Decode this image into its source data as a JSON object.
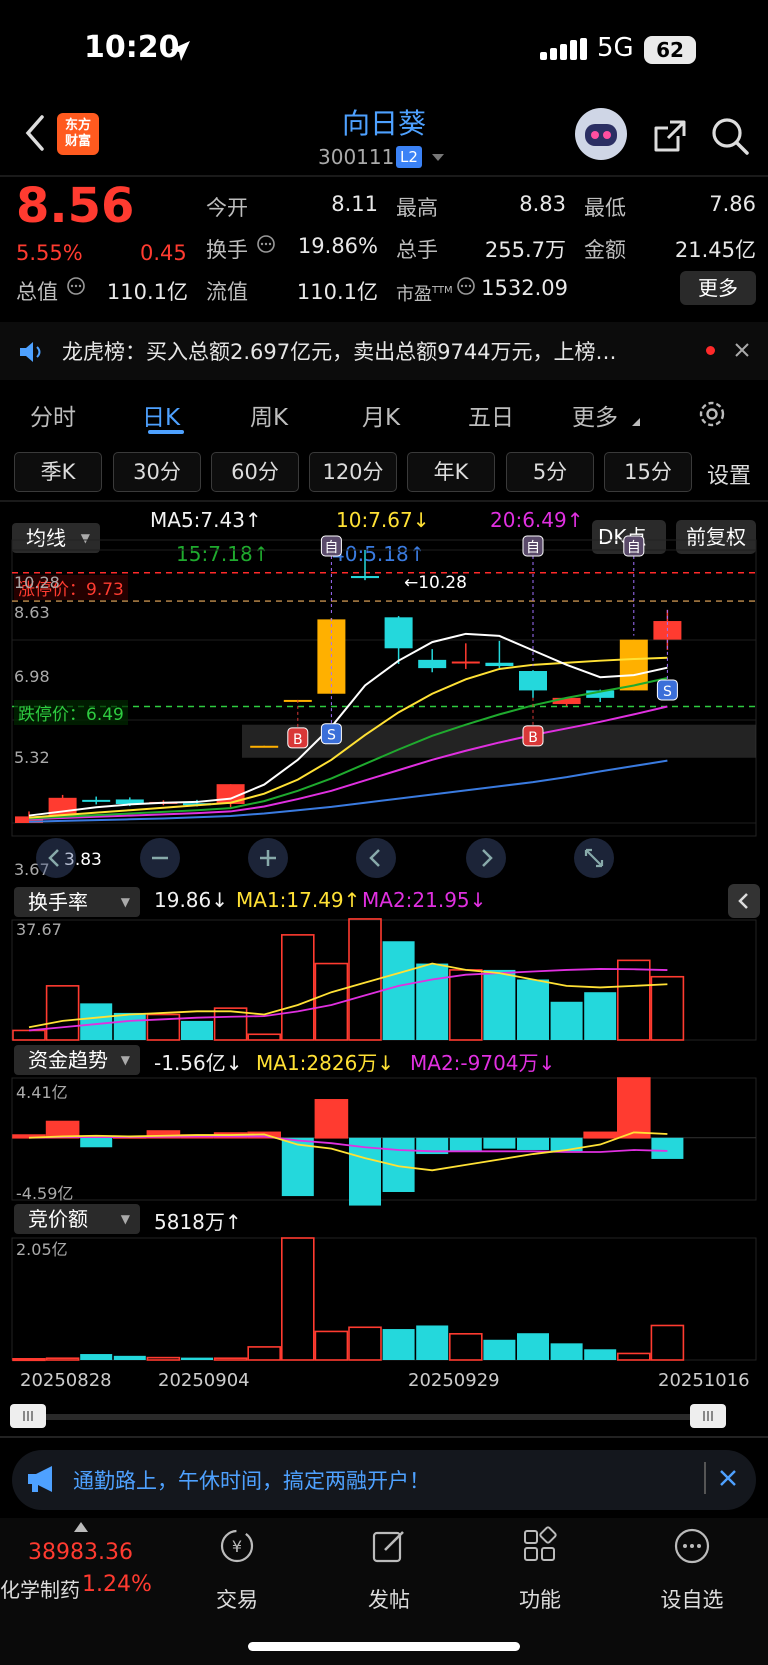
{
  "status_bar": {
    "time": "10:20",
    "network": "5G",
    "battery": "62"
  },
  "header": {
    "logo_text_1": "东方",
    "logo_text_2": "财富",
    "stock_name": "向日葵",
    "stock_code": "300111",
    "level": "L2"
  },
  "quote": {
    "price": "8.56",
    "change_pct": "5.55%",
    "change": "0.45",
    "open_label": "今开",
    "open": "8.11",
    "high_label": "最高",
    "high": "8.83",
    "low_label": "最低",
    "low": "7.86",
    "turnover_label": "换手",
    "turnover": "19.86%",
    "volume_label": "总手",
    "volume": "255.7万",
    "amount_label": "金额",
    "amount": "21.45亿",
    "mktcap_label": "总值",
    "mktcap": "110.1亿",
    "float_label": "流值",
    "float": "110.1亿",
    "pe_label": "市盈",
    "pe_sup": "TTM",
    "pe": "1532.09",
    "more_label": "更多"
  },
  "news": {
    "text": "龙虎榜：买入总额2.697亿元，卖出总额9744万元，上榜…"
  },
  "tabs": [
    "分时",
    "日K",
    "周K",
    "月K",
    "五日",
    "更多"
  ],
  "periods": [
    "季K",
    "30分",
    "60分",
    "120分",
    "年K",
    "5分",
    "15分"
  ],
  "settings_label": "设置",
  "ma_legend": {
    "selector": "均线",
    "ma5": "MA5:7.43↑",
    "ma10": "10:7.67↓",
    "ma20": "20:6.49↑",
    "ma15": "15:7.18↑",
    "ma40": "40:5.18↑",
    "dk_label": "DK点",
    "adjust_label": "前复权"
  },
  "colors": {
    "up": "#ff3b30",
    "down": "#24d8dc",
    "yellow_candle": "#ffb000",
    "ma5": "#ffffff",
    "ma10": "#ffe135",
    "ma20": "#e030e0",
    "ma15": "#1faa2e",
    "ma40": "#3a7be0",
    "accent": "#4ea1ff"
  },
  "chart_data": [
    {
      "type": "candlestick",
      "title": "日K",
      "y_ticks": [
        "10.28",
        "8.63",
        "6.98",
        "5.32",
        "3.67"
      ],
      "limit_up_label": "涨停价：9.73",
      "limit_up": 9.73,
      "limit_down_label": "跌停价：6.49",
      "limit_down": 6.49,
      "current_price_line": 8.56,
      "high_marker": "←10.28",
      "low_marker": "3.83",
      "x_labels": [
        "20250828",
        "20250904",
        "20250929",
        "20251016"
      ],
      "ylim": [
        3.67,
        10.28
      ],
      "candles": [
        {
          "o": 3.67,
          "c": 3.83,
          "h": 3.95,
          "l": 3.67,
          "color": "up"
        },
        {
          "o": 3.83,
          "c": 4.28,
          "h": 4.35,
          "l": 3.78,
          "color": "up"
        },
        {
          "o": 4.23,
          "c": 4.2,
          "h": 4.31,
          "l": 4.12,
          "color": "down"
        },
        {
          "o": 4.24,
          "c": 4.13,
          "h": 4.29,
          "l": 4.08,
          "color": "down"
        },
        {
          "o": 4.17,
          "c": 4.18,
          "h": 4.22,
          "l": 4.1,
          "color": "up"
        },
        {
          "o": 4.15,
          "c": 4.13,
          "h": 4.23,
          "l": 4.07,
          "color": "down"
        },
        {
          "o": 4.13,
          "c": 4.61,
          "h": 4.61,
          "l": 4.05,
          "color": "up"
        },
        {
          "o": 5.52,
          "c": 5.54,
          "h": 5.54,
          "l": 5.52,
          "color": "yellow_candle"
        },
        {
          "o": 6.65,
          "c": 6.65,
          "h": 6.65,
          "l": 6.65,
          "color": "yellow_candle"
        },
        {
          "o": 6.8,
          "c": 8.6,
          "h": 8.63,
          "l": 6.8,
          "color": "yellow_candle"
        },
        {
          "o": 9.65,
          "c": 9.6,
          "h": 10.28,
          "l": 9.55,
          "color": "down"
        },
        {
          "o": 8.65,
          "c": 7.9,
          "h": 8.68,
          "l": 7.52,
          "color": "down"
        },
        {
          "o": 7.62,
          "c": 7.42,
          "h": 7.88,
          "l": 7.32,
          "color": "down"
        },
        {
          "o": 7.55,
          "c": 7.58,
          "h": 8.02,
          "l": 7.4,
          "color": "up"
        },
        {
          "o": 7.55,
          "c": 7.47,
          "h": 8.08,
          "l": 7.42,
          "color": "down"
        },
        {
          "o": 7.35,
          "c": 6.88,
          "h": 7.37,
          "l": 6.7,
          "color": "down"
        },
        {
          "o": 6.7,
          "c": 6.55,
          "h": 6.72,
          "l": 6.5,
          "color": "up"
        },
        {
          "o": 6.88,
          "c": 6.7,
          "h": 6.9,
          "l": 6.6,
          "color": "down"
        },
        {
          "o": 6.88,
          "c": 8.11,
          "h": 8.11,
          "l": 6.88,
          "color": "yellow_candle"
        },
        {
          "o": 8.11,
          "c": 8.56,
          "h": 8.83,
          "l": 7.86,
          "color": "up"
        }
      ],
      "ma5": [
        3.85,
        3.95,
        4.05,
        4.12,
        4.16,
        4.18,
        4.26,
        4.6,
        5.2,
        6.0,
        7.0,
        7.6,
        8.05,
        8.25,
        8.2,
        7.85,
        7.5,
        7.2,
        7.25,
        7.43
      ],
      "ma10": [
        3.8,
        3.86,
        3.92,
        3.98,
        4.04,
        4.1,
        4.16,
        4.38,
        4.72,
        5.2,
        5.8,
        6.35,
        6.8,
        7.15,
        7.4,
        7.5,
        7.55,
        7.6,
        7.64,
        7.67
      ],
      "ma15": [
        3.78,
        3.82,
        3.86,
        3.9,
        3.94,
        3.98,
        4.03,
        4.2,
        4.45,
        4.75,
        5.1,
        5.45,
        5.78,
        6.05,
        6.3,
        6.52,
        6.7,
        6.85,
        7.0,
        7.18
      ],
      "ma20": [
        3.76,
        3.79,
        3.82,
        3.85,
        3.88,
        3.91,
        3.95,
        4.07,
        4.25,
        4.45,
        4.7,
        4.95,
        5.2,
        5.42,
        5.62,
        5.8,
        5.96,
        6.12,
        6.3,
        6.49
      ],
      "ma40": [
        3.7,
        3.72,
        3.74,
        3.76,
        3.78,
        3.81,
        3.84,
        3.9,
        3.98,
        4.06,
        4.16,
        4.26,
        4.36,
        4.46,
        4.56,
        4.66,
        4.78,
        4.92,
        5.05,
        5.18
      ],
      "markers": [
        {
          "i": 8,
          "label": "B",
          "kind": "buy"
        },
        {
          "i": 9,
          "label": "S",
          "kind": "sell"
        },
        {
          "i": 9,
          "label": "自",
          "kind": "self"
        },
        {
          "i": 15,
          "label": "B",
          "kind": "buy"
        },
        {
          "i": 15,
          "label": "自",
          "kind": "self"
        },
        {
          "i": 18,
          "label": "自",
          "kind": "self"
        },
        {
          "i": 19,
          "label": "S",
          "kind": "sell"
        }
      ]
    },
    {
      "type": "bar",
      "title": "换手率",
      "legend": {
        "value": "19.86↓",
        "ma1": "MA1:17.49↑",
        "ma2": "MA2:21.95↓"
      },
      "y_ticks": [
        "37.67"
      ],
      "ylim": [
        0,
        37.67
      ],
      "values": [
        3.0,
        17.0,
        11.5,
        8.5,
        8.0,
        6.0,
        10.0,
        1.8,
        33.0,
        24.0,
        38.0,
        31.0,
        24.0,
        22.0,
        22.0,
        19.0,
        12.0,
        15.0,
        25.0,
        19.86
      ],
      "colors": [
        "up",
        "up",
        "down",
        "down",
        "up",
        "down",
        "up",
        "up",
        "up",
        "up",
        "up",
        "down",
        "down",
        "up",
        "down",
        "down",
        "down",
        "down",
        "up",
        "up"
      ],
      "ma1": [
        4,
        6,
        7,
        8,
        8.5,
        9,
        9,
        8,
        11,
        15,
        18,
        21,
        24,
        22,
        21,
        19,
        17,
        16.5,
        17,
        17.49
      ],
      "ma2": [
        3,
        4,
        5,
        6,
        6.5,
        7,
        7.3,
        7.5,
        9,
        11,
        14,
        17,
        19,
        20.5,
        21,
        21.5,
        22,
        22.3,
        22.2,
        21.95
      ]
    },
    {
      "type": "bar",
      "title": "资金趋势",
      "legend": {
        "value": "-1.56亿↓",
        "ma1": "MA1:2826万↓",
        "ma2": "MA2:-9704万↓"
      },
      "y_ticks": [
        "4.41亿",
        "-4.59亿"
      ],
      "ylim": [
        -4.59,
        4.41
      ],
      "values": [
        0.2,
        1.2,
        -0.7,
        0.1,
        0.5,
        0.2,
        0.35,
        0.4,
        -4.3,
        2.8,
        -5.0,
        -4.0,
        -1.2,
        -1.0,
        -0.8,
        -0.9,
        -1.0,
        0.4,
        4.41,
        -1.56
      ],
      "ma1": [
        0,
        0.1,
        0.15,
        0.1,
        0.15,
        0.2,
        0.2,
        0.25,
        -0.5,
        -0.8,
        -1.5,
        -2.1,
        -2.4,
        -2.0,
        -1.6,
        -1.2,
        -0.9,
        -0.5,
        0.4,
        0.28
      ],
      "ma2": [
        0,
        0.05,
        0.05,
        0.05,
        0.08,
        0.1,
        0.1,
        0.1,
        -0.2,
        -0.4,
        -0.7,
        -0.9,
        -1.0,
        -1.0,
        -1.0,
        -1.0,
        -1.05,
        -1.05,
        -0.9,
        -0.97
      ]
    },
    {
      "type": "bar",
      "title": "竞价额",
      "legend": {
        "value": "5818万↑"
      },
      "y_ticks": [
        "2.05亿"
      ],
      "ylim": [
        0,
        2.05
      ],
      "values": [
        0.02,
        0.03,
        0.1,
        0.07,
        0.04,
        0.04,
        0.03,
        0.22,
        2.05,
        0.48,
        0.55,
        0.52,
        0.58,
        0.44,
        0.34,
        0.45,
        0.28,
        0.18,
        0.11,
        0.58
      ],
      "colors": [
        "up",
        "up",
        "down",
        "down",
        "up",
        "down",
        "up",
        "up",
        "up",
        "up",
        "up",
        "down",
        "down",
        "up",
        "down",
        "down",
        "down",
        "down",
        "up",
        "up"
      ]
    }
  ],
  "promo": {
    "text": "通勤路上，午休时间，搞定两融开户！"
  },
  "bottom_nav": {
    "index_value": "38983.36",
    "index_name": "化学制药",
    "index_pct": "1.24%",
    "items": [
      "交易",
      "发帖",
      "功能",
      "设自选"
    ]
  }
}
